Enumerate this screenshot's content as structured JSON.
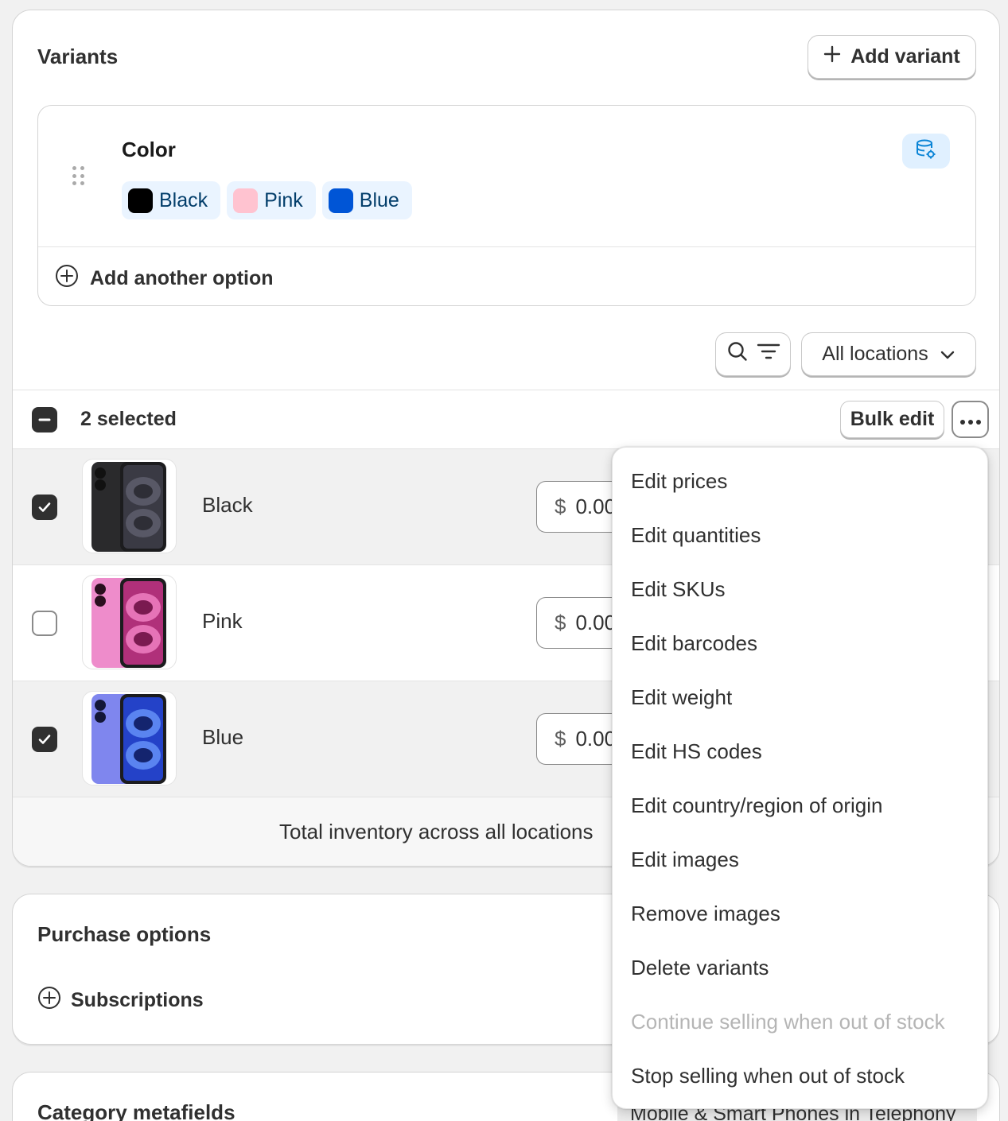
{
  "variants_card": {
    "title": "Variants",
    "add_variant_label": "Add variant",
    "option": {
      "name": "Color",
      "values": [
        {
          "label": "Black",
          "color": "#000000"
        },
        {
          "label": "Pink",
          "color": "#ffc3d0"
        },
        {
          "label": "Blue",
          "color": "#0055d6"
        }
      ]
    },
    "add_option_label": "Add another option",
    "locations_label": "All locations",
    "selected_count": "2 selected",
    "bulk_edit_label": "Bulk edit",
    "rows": [
      {
        "name": "Black",
        "currency": "$",
        "price": "0.00",
        "selected": true
      },
      {
        "name": "Pink",
        "currency": "$",
        "price": "0.00",
        "selected": false
      },
      {
        "name": "Blue",
        "currency": "$",
        "price": "0.00",
        "selected": true
      }
    ],
    "total_inventory": "Total inventory across all locations"
  },
  "purchase_card": {
    "title": "Purchase options",
    "subscriptions_label": "Subscriptions"
  },
  "metafields_card": {
    "title": "Category metafields",
    "category_text": "Mobile & Smart Phones in Telephony"
  },
  "more_menu": {
    "items": [
      {
        "label": "Edit prices",
        "disabled": false
      },
      {
        "label": "Edit quantities",
        "disabled": false
      },
      {
        "label": "Edit SKUs",
        "disabled": false
      },
      {
        "label": "Edit barcodes",
        "disabled": false
      },
      {
        "label": "Edit weight",
        "disabled": false
      },
      {
        "label": "Edit HS codes",
        "disabled": false
      },
      {
        "label": "Edit country/region of origin",
        "disabled": false
      },
      {
        "label": "Edit images",
        "disabled": false
      },
      {
        "label": "Remove images",
        "disabled": false
      },
      {
        "label": "Delete variants",
        "disabled": false
      },
      {
        "label": "Continue selling when out of stock",
        "disabled": true
      },
      {
        "label": "Stop selling when out of stock",
        "disabled": false
      }
    ]
  },
  "colors": {
    "accent": "#005bd3",
    "chip_bg": "#eaf4ff",
    "selected_row_bg": "#f1f1f1"
  }
}
